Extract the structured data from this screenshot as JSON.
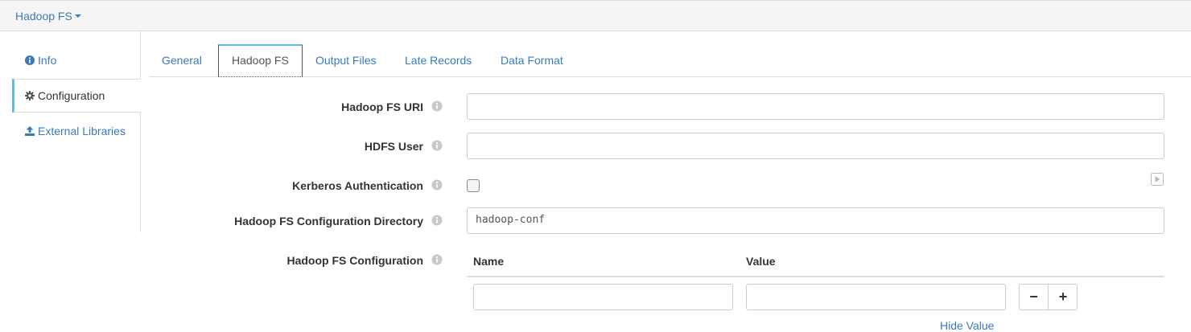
{
  "topbar": {
    "stage_label": "Hadoop FS"
  },
  "sidebar": {
    "items": [
      {
        "label": "Info",
        "icon": "info-icon"
      },
      {
        "label": "Configuration",
        "icon": "gear-icon"
      },
      {
        "label": "External Libraries",
        "icon": "upload-icon"
      }
    ]
  },
  "tabs": [
    {
      "label": "General"
    },
    {
      "label": "Hadoop FS"
    },
    {
      "label": "Output Files"
    },
    {
      "label": "Late Records"
    },
    {
      "label": "Data Format"
    }
  ],
  "form": {
    "fs_uri": {
      "label": "Hadoop FS URI",
      "value": ""
    },
    "hdfs_user": {
      "label": "HDFS User",
      "value": ""
    },
    "kerberos": {
      "label": "Kerberos Authentication",
      "checked": false
    },
    "config_dir": {
      "label": "Hadoop FS Configuration Directory",
      "value": "hadoop-conf"
    },
    "fs_config": {
      "label": "Hadoop FS Configuration",
      "name_header": "Name",
      "value_header": "Value",
      "rows": [
        {
          "name": "",
          "value": ""
        }
      ],
      "remove_label": "−",
      "add_label": "+",
      "hide_value_label": "Hide Value"
    }
  },
  "colors": {
    "link": "#3a7ab8",
    "accent": "#5bc0de",
    "text": "#333333",
    "border": "#cccccc"
  }
}
